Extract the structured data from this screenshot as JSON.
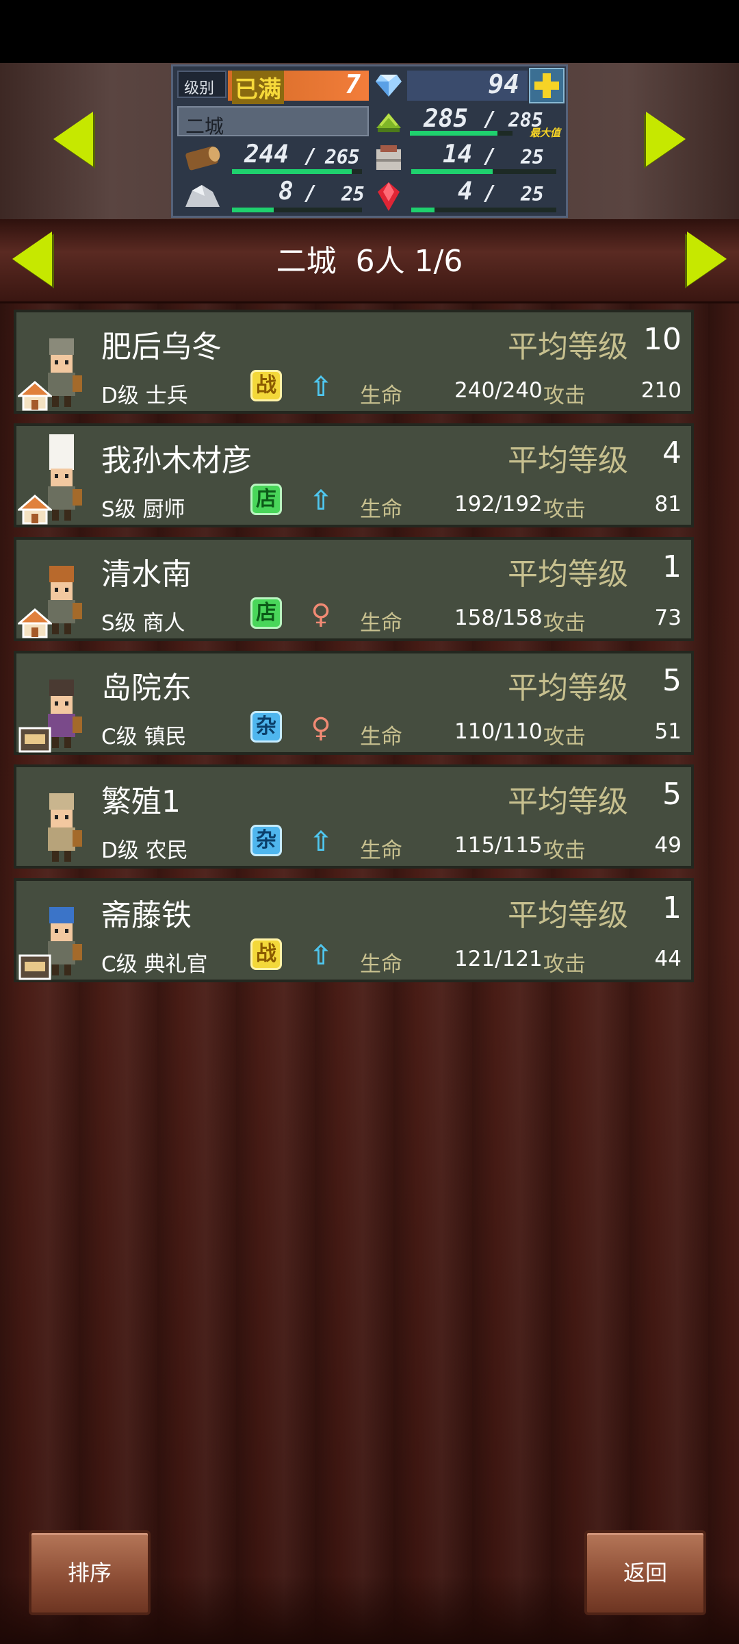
{
  "resources": {
    "level_label": "级别",
    "level_status": "已满",
    "level_value": "7",
    "gems": "94",
    "town_name": "二城",
    "food": "285",
    "food_max": "285",
    "food_max_label": "最大值",
    "wood": "244",
    "wood_max": "265",
    "material": "14",
    "material_max": "25",
    "ore": "8",
    "ore_max": "25",
    "gem_red": "4",
    "gem_red_max": "25",
    "progress": {
      "wood": 0.92,
      "food": 0.85,
      "material": 0.56,
      "ore": 0.32,
      "gem_red": 0.16
    }
  },
  "header": {
    "title": "二城  6人 1/6"
  },
  "residents": [
    {
      "name": "肥后乌冬",
      "avg_label": "平均等级",
      "avg_level": "10",
      "rank": "D级 士兵",
      "badge": "战",
      "badge_type": "battle",
      "gender": "male",
      "hp_label": "生命",
      "hp": "240/240",
      "atk_label": "攻击",
      "atk": "210",
      "home": "house"
    },
    {
      "name": "我孙木材彦",
      "avg_label": "平均等级",
      "avg_level": "4",
      "rank": "S级 厨师",
      "badge": "店",
      "badge_type": "shop",
      "gender": "male",
      "hp_label": "生命",
      "hp": "192/192",
      "atk_label": "攻击",
      "atk": "81",
      "home": "house"
    },
    {
      "name": "清水南",
      "avg_label": "平均等级",
      "avg_level": "1",
      "rank": "S级 商人",
      "badge": "店",
      "badge_type": "shop",
      "gender": "female",
      "hp_label": "生命",
      "hp": "158/158",
      "atk_label": "攻击",
      "atk": "73",
      "home": "house"
    },
    {
      "name": "岛院东",
      "avg_label": "平均等级",
      "avg_level": "5",
      "rank": "C级 镇民",
      "badge": "杂",
      "badge_type": "misc",
      "gender": "female",
      "hp_label": "生命",
      "hp": "110/110",
      "atk_label": "攻击",
      "atk": "51",
      "home": "bed"
    },
    {
      "name": "繁殖1",
      "avg_label": "平均等级",
      "avg_level": "5",
      "rank": "D级 农民",
      "badge": "杂",
      "badge_type": "misc",
      "gender": "male",
      "hp_label": "生命",
      "hp": "115/115",
      "atk_label": "攻击",
      "atk": "49",
      "home": "none"
    },
    {
      "name": "斋藤铁",
      "avg_label": "平均等级",
      "avg_level": "1",
      "rank": "C级 典礼官",
      "badge": "战",
      "badge_type": "battle",
      "gender": "male",
      "hp_label": "生命",
      "hp": "121/121",
      "atk_label": "攻击",
      "atk": "44",
      "home": "bed"
    }
  ],
  "buttons": {
    "sort": "排序",
    "back": "返回"
  },
  "icons": {
    "gem": "diamond-icon",
    "add": "plus-icon",
    "food": "grain-icon",
    "wood": "log-icon",
    "material": "cloth-icon",
    "ore": "ore-icon",
    "gem_red": "ruby-icon",
    "male": "male-icon",
    "female": "female-icon",
    "house": "house-icon",
    "bed": "bed-icon"
  },
  "colors": {
    "accent_arrow": "#c6e800",
    "progress": "#1fd16e",
    "card_bg": "#454d3f",
    "badge_battle": "#f3d83a",
    "badge_shop": "#49d65a",
    "badge_misc": "#4fb6ee",
    "male": "#4fc6ee",
    "female": "#f08a74"
  }
}
